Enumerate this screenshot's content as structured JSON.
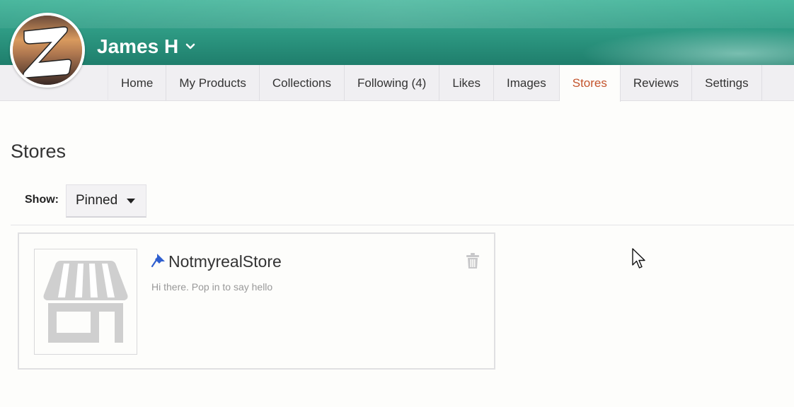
{
  "user": {
    "name": "James H",
    "avatar_icon": "avatar-icon",
    "dropdown_icon": "chevron-down-icon"
  },
  "nav": {
    "tabs": [
      {
        "label": "Home",
        "active": false
      },
      {
        "label": "My Products",
        "active": false
      },
      {
        "label": "Collections",
        "active": false
      },
      {
        "label": "Following (4)",
        "active": false
      },
      {
        "label": "Likes",
        "active": false
      },
      {
        "label": "Images",
        "active": false
      },
      {
        "label": "Stores",
        "active": true
      },
      {
        "label": "Reviews",
        "active": false
      },
      {
        "label": "Settings",
        "active": false
      }
    ]
  },
  "page": {
    "title": "Stores"
  },
  "filter": {
    "label": "Show:",
    "selected": "Pinned"
  },
  "stores": [
    {
      "name": "NotmyrealStore",
      "description": "Hi there. Pop in to say hello",
      "pinned": true,
      "thumbnail_icon": "storefront-icon",
      "delete_icon": "trash-icon"
    }
  ],
  "colors": {
    "banner": "#2f9c85",
    "active_tab": "#c4542c",
    "pin": "#2f5fcf"
  }
}
